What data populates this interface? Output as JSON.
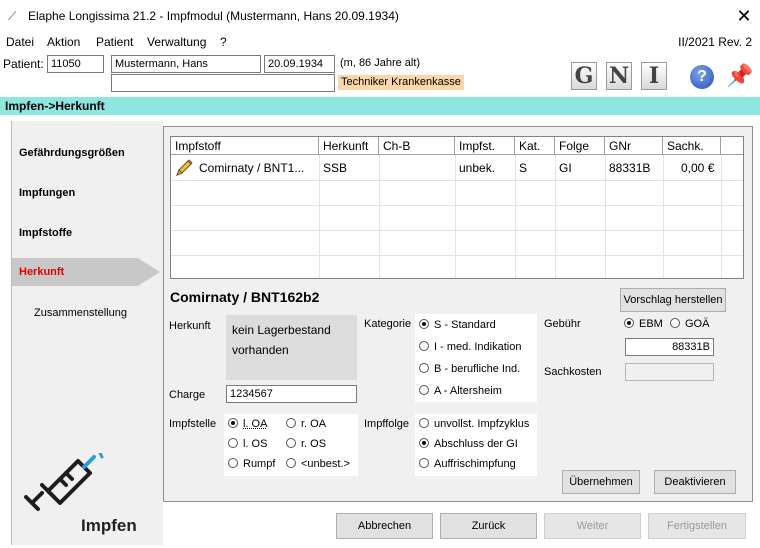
{
  "window": {
    "title": "Elaphe Longissima 21.2 - Impfmodul (Mustermann, Hans  20.09.1934)",
    "close_glyph": "✕",
    "icon_glyph": "⟋"
  },
  "menu": {
    "items": [
      "Datei",
      "Aktion",
      "Patient",
      "Verwaltung",
      "?"
    ],
    "version": "II/2021 Rev. 2"
  },
  "patient": {
    "label": "Patient:",
    "id": "11050",
    "name": "Mustermann, Hans",
    "dob": "20.09.1934",
    "info": "(m, 86 Jahre alt)",
    "kasse": "Techniker Krankenkasse"
  },
  "toolbar": {
    "g": "G",
    "n": "N",
    "i": "I",
    "help": "?",
    "pin": "📌"
  },
  "section_title": "Impfen->Herkunft",
  "nav": {
    "items": [
      "Gefährdungsgrößen",
      "Impfungen",
      "Impfstoffe",
      "Herkunft",
      "Zusammenstellung"
    ],
    "module_label": "Impfen"
  },
  "grid": {
    "headers": [
      "Impfstoff",
      "Herkunft",
      "Ch-B",
      "Impfst.",
      "Kat.",
      "Folge",
      "GNr",
      "Sachk."
    ],
    "rows": [
      [
        "Comirnaty / BNT1...",
        "SSB",
        "",
        "unbek.",
        "S",
        "GI",
        "88331B",
        "0,00 €"
      ]
    ]
  },
  "detail": {
    "title": "Comirnaty / BNT162b2",
    "vorschlag_button": "Vorschlag herstellen",
    "herkunft_label": "Herkunft",
    "herkunft_line1": "kein Lagerbestand",
    "herkunft_line2": "vorhanden",
    "charge_label": "Charge",
    "charge_value": "1234567",
    "kategorie_label": "Kategorie",
    "kategorie_options": [
      "S - Standard",
      "I - med. Indikation",
      "B - berufliche Ind.",
      "A - Altersheim"
    ],
    "kategorie_selected": "S - Standard",
    "gebuehr_label": "Gebühr",
    "gebuehr_options": [
      "EBM",
      "GOÄ"
    ],
    "gebuehr_selected": "EBM",
    "gebuehr_value": "88331B",
    "sachkosten_label": "Sachkosten",
    "sachkosten_value": "",
    "impfstelle_label": "Impfstelle",
    "impfstelle_options": [
      "l. OA",
      "r. OA",
      "l. OS",
      "r. OS",
      "Rumpf",
      "<unbest.>"
    ],
    "impfstelle_selected": "l. OA",
    "impffolge_label": "Impffolge",
    "impffolge_options": [
      "unvollst. Impfzyklus",
      "Abschluss der GI",
      "Auffrischimpfung"
    ],
    "impffolge_selected": "Abschluss der GI",
    "uebernehmen_button": "Übernehmen",
    "deaktivieren_button": "Deaktivieren"
  },
  "footer": {
    "abbrechen": "Abbrechen",
    "zurueck": "Zurück",
    "weiter": "Weiter",
    "fertigstellen": "Fertigstellen"
  },
  "colors": {
    "section_bg": "#8ee6e0",
    "kasse_bg": "#fbd6a6",
    "active_nav_text": "#e00000"
  }
}
